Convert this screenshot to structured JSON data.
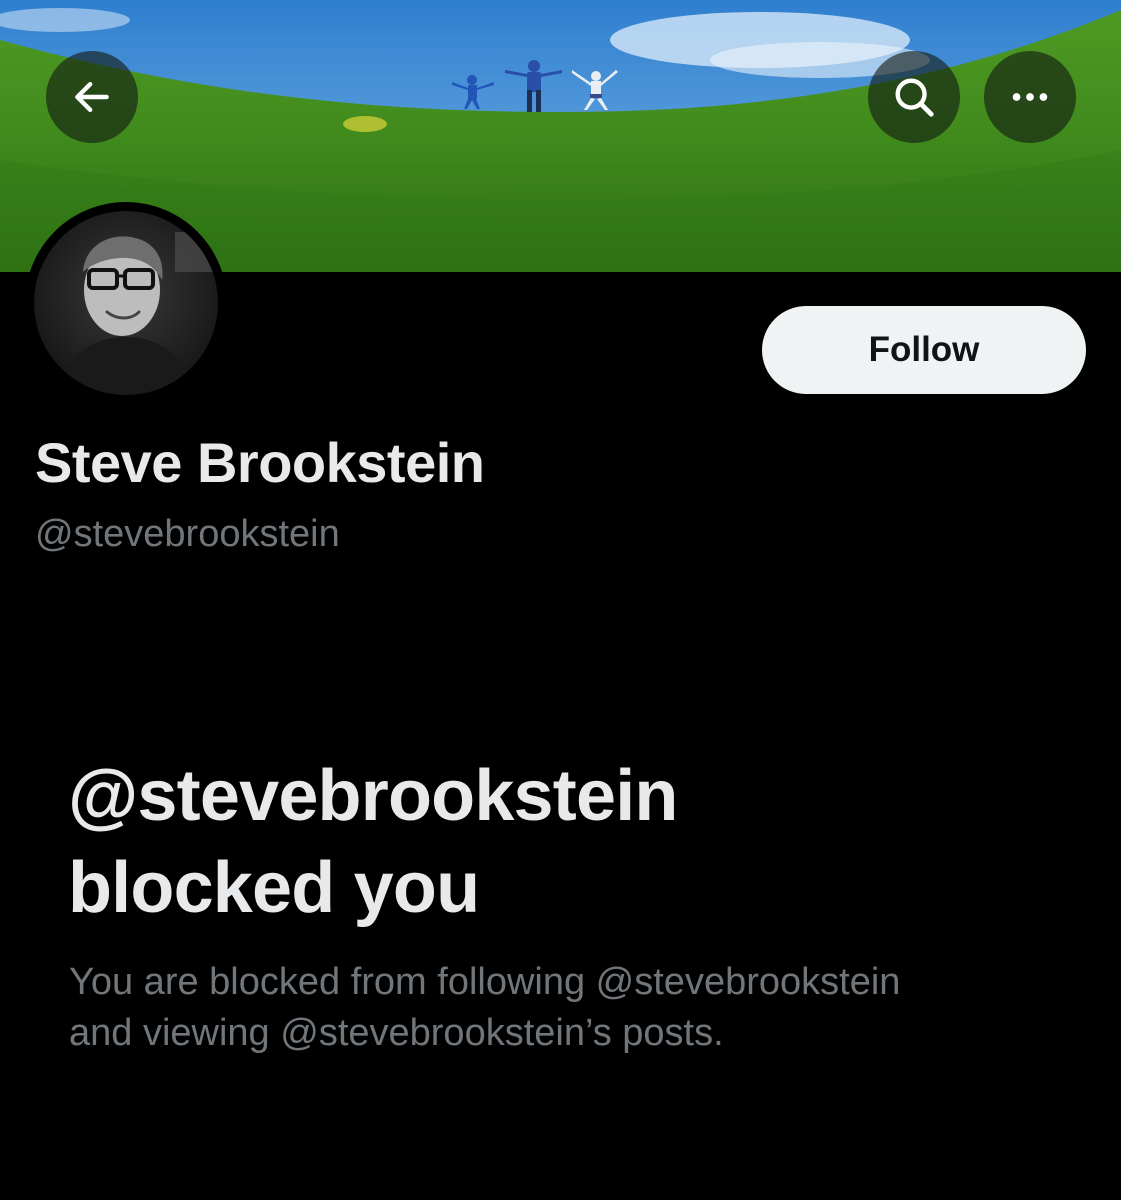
{
  "header": {
    "back_icon": "arrow-left-icon",
    "search_icon": "search-icon",
    "more_icon": "more-horizontal-icon"
  },
  "profile": {
    "display_name": "Steve Brookstein",
    "handle": "@stevebrookstein",
    "follow_label": "Follow"
  },
  "blocked": {
    "title_line1": "@stevebrookstein",
    "title_line2": "blocked you",
    "desc_line1": "You are blocked from following @stevebrookstein",
    "desc_line2": "and viewing @stevebrookstein’s posts."
  },
  "colors": {
    "background": "#000000",
    "primary_text": "#e7e9ea",
    "secondary_text": "#71767b",
    "follow_bg": "#eff3f4",
    "follow_text": "#0f1419"
  }
}
